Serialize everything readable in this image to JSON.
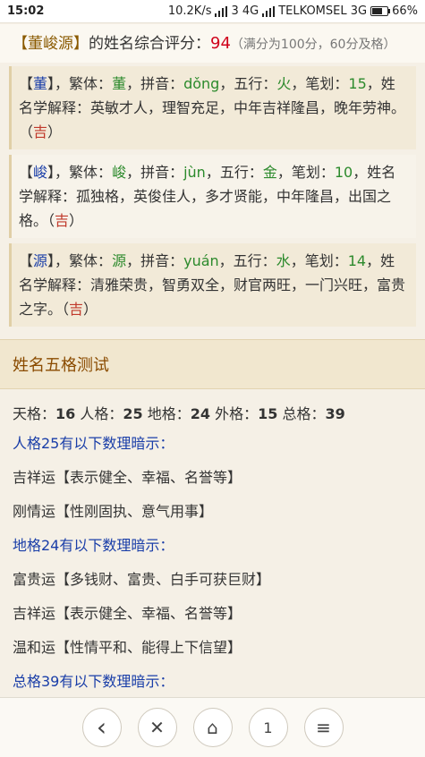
{
  "status": {
    "time": "15:02",
    "speed": "10.2K/s",
    "sim1": "3 4G",
    "carrier": "TELKOMSEL 3G",
    "battery": "66%"
  },
  "score": {
    "name": "【董峻源】",
    "prefix": "的姓名综合评分：",
    "value": "94",
    "note": "（满分为100分，60分及格）"
  },
  "chars": [
    {
      "bracket_open": "【",
      "char": "董",
      "bracket_close": "】",
      "trad_label": "，繁体：",
      "trad": "董",
      "pinyin_label": "，拼音：",
      "pinyin": "dǒng",
      "wuxing_label": "，五行：",
      "wuxing": "火",
      "strokes_label": "，笔划：",
      "strokes": "15",
      "meaning_label": "，姓名学解释：",
      "meaning": "英敏才人，理智充足，中年吉祥隆昌，晚年劳神。",
      "luck_open": "（",
      "luck": "吉",
      "luck_close": "）"
    },
    {
      "bracket_open": "【",
      "char": "峻",
      "bracket_close": "】",
      "trad_label": "，繁体：",
      "trad": "峻",
      "pinyin_label": "，拼音：",
      "pinyin": "jùn",
      "wuxing_label": "，五行：",
      "wuxing": "金",
      "strokes_label": "，笔划：",
      "strokes": "10",
      "meaning_label": "，姓名学解释：",
      "meaning": "孤独格，英俊佳人，多才贤能，中年隆昌，出国之格。",
      "luck_open": "（",
      "luck": "吉",
      "luck_close": "）"
    },
    {
      "bracket_open": "【",
      "char": "源",
      "bracket_close": "】",
      "trad_label": "，繁体：",
      "trad": "源",
      "pinyin_label": "，拼音：",
      "pinyin": "yuán",
      "wuxing_label": "，五行：",
      "wuxing": "水",
      "strokes_label": "，笔划：",
      "strokes": "14",
      "meaning_label": "，姓名学解释：",
      "meaning": "清雅荣贵，智勇双全，财官两旺，一门兴旺，富贵之字。",
      "luck_open": "（",
      "luck": "吉",
      "luck_close": "）"
    }
  ],
  "wuge": {
    "title": "姓名五格测试",
    "tian_label": "天格：",
    "tian": "16",
    "ren_label": "人格：",
    "ren": "25",
    "di_label": "地格：",
    "di": "24",
    "wai_label": "外格：",
    "wai": "15",
    "zong_label": "总格：",
    "zong": "39",
    "lines": [
      {
        "text": "人格25有以下数理暗示：",
        "hint": true
      },
      {
        "text": "吉祥运【表示健全、幸福、名誉等】",
        "hint": false
      },
      {
        "text": "刚情运【性刚固执、意气用事】",
        "hint": false
      },
      {
        "text": "地格24有以下数理暗示：",
        "hint": true
      },
      {
        "text": "富贵运【多钱财、富贵、白手可获巨财】",
        "hint": false
      },
      {
        "text": "吉祥运【表示健全、幸福、名誉等】",
        "hint": false
      },
      {
        "text": "温和运【性情平和、能得上下信望】",
        "hint": false
      },
      {
        "text": "总格39有以下数理暗示：",
        "hint": true
      }
    ]
  },
  "nav": {
    "back": "‹",
    "close": "✕",
    "home": "⌂",
    "tabs": "1",
    "menu": "≡"
  }
}
